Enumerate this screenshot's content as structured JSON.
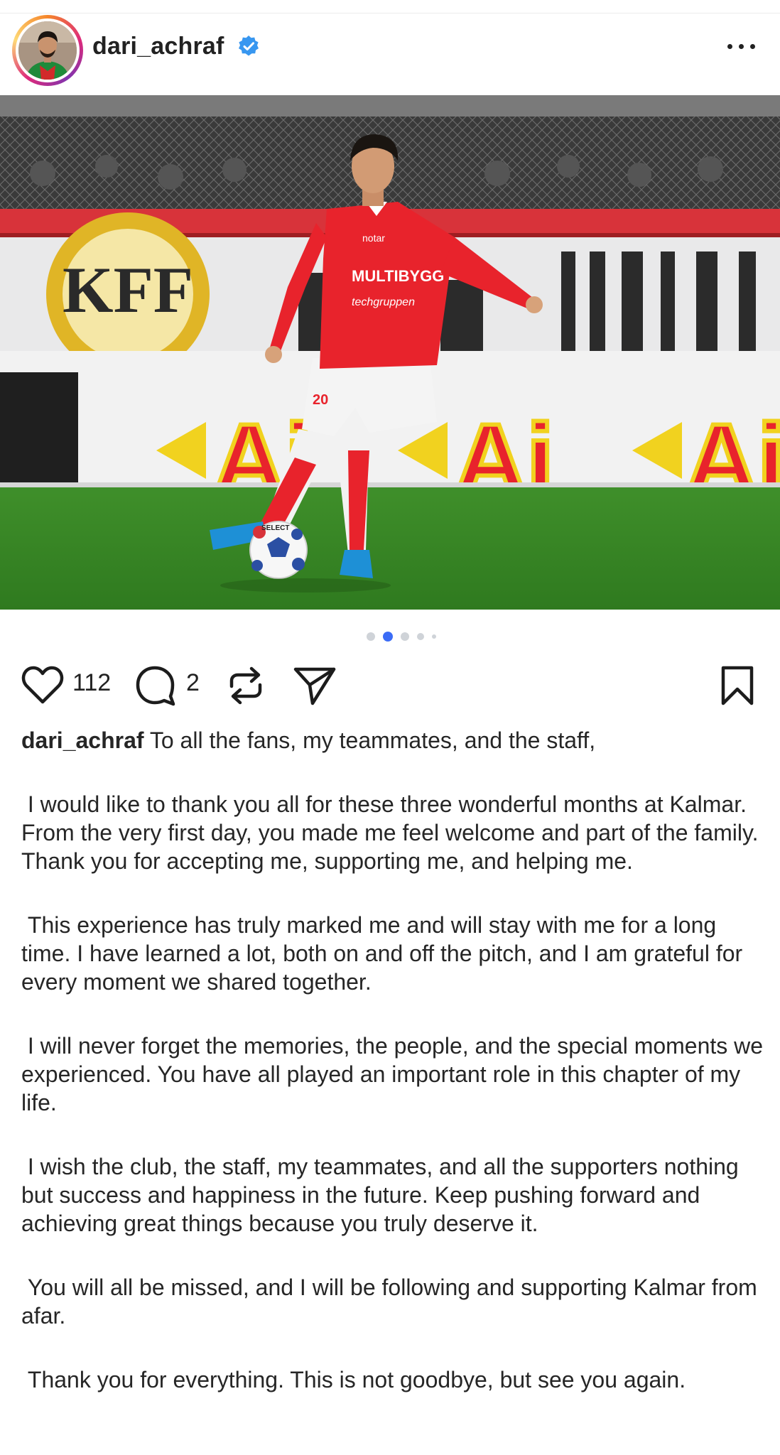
{
  "post": {
    "username": "dari_achraf",
    "verified": true,
    "likes": "112",
    "comments": "2",
    "carousel": {
      "total": 5,
      "active": 1
    }
  },
  "caption": {
    "author": "dari_achraf",
    "paragraphs": [
      "To all the fans, my teammates, and the staff,",
      "I would like to thank you all for these three wonderful months at Kalmar. From the very first day, you made me feel welcome and part of the family. Thank you for accepting me, supporting me, and helping me.",
      "This experience has truly marked me and will stay with me for a long time. I have learned a lot, both on and off the pitch, and I am grateful for every moment we shared together.",
      "I will never forget the memories, the people, and the special moments we experienced. You have all played an important role in this chapter of my life.",
      "I wish the club, the staff, my teammates, and all the supporters nothing but success and happiness in the future. Keep pushing forward and achieving great things because you truly deserve it.",
      "You will all be missed, and I will be following and supporting Kalmar from afar.",
      "Thank you for everything. This is not goodbye, but see you again."
    ]
  },
  "photo": {
    "banner_text_1": "KFF",
    "banner_text_2": "Aj",
    "shirt_sponsor": "MULTIBYGG",
    "shirt_sponsor_2": "techgruppen",
    "shirt_top_sponsor": "notar",
    "shorts_number": "20",
    "ball_brand": "SELECT"
  },
  "icons": {
    "verified": "verified-badge-icon",
    "more": "more-options-icon",
    "like": "heart-icon",
    "comment": "comment-icon",
    "repost": "repost-icon",
    "share": "send-icon",
    "save": "bookmark-icon"
  },
  "colors": {
    "verified_blue": "#3897f0",
    "carousel_active": "#3b6cf6",
    "kit_red": "#e8232c"
  }
}
